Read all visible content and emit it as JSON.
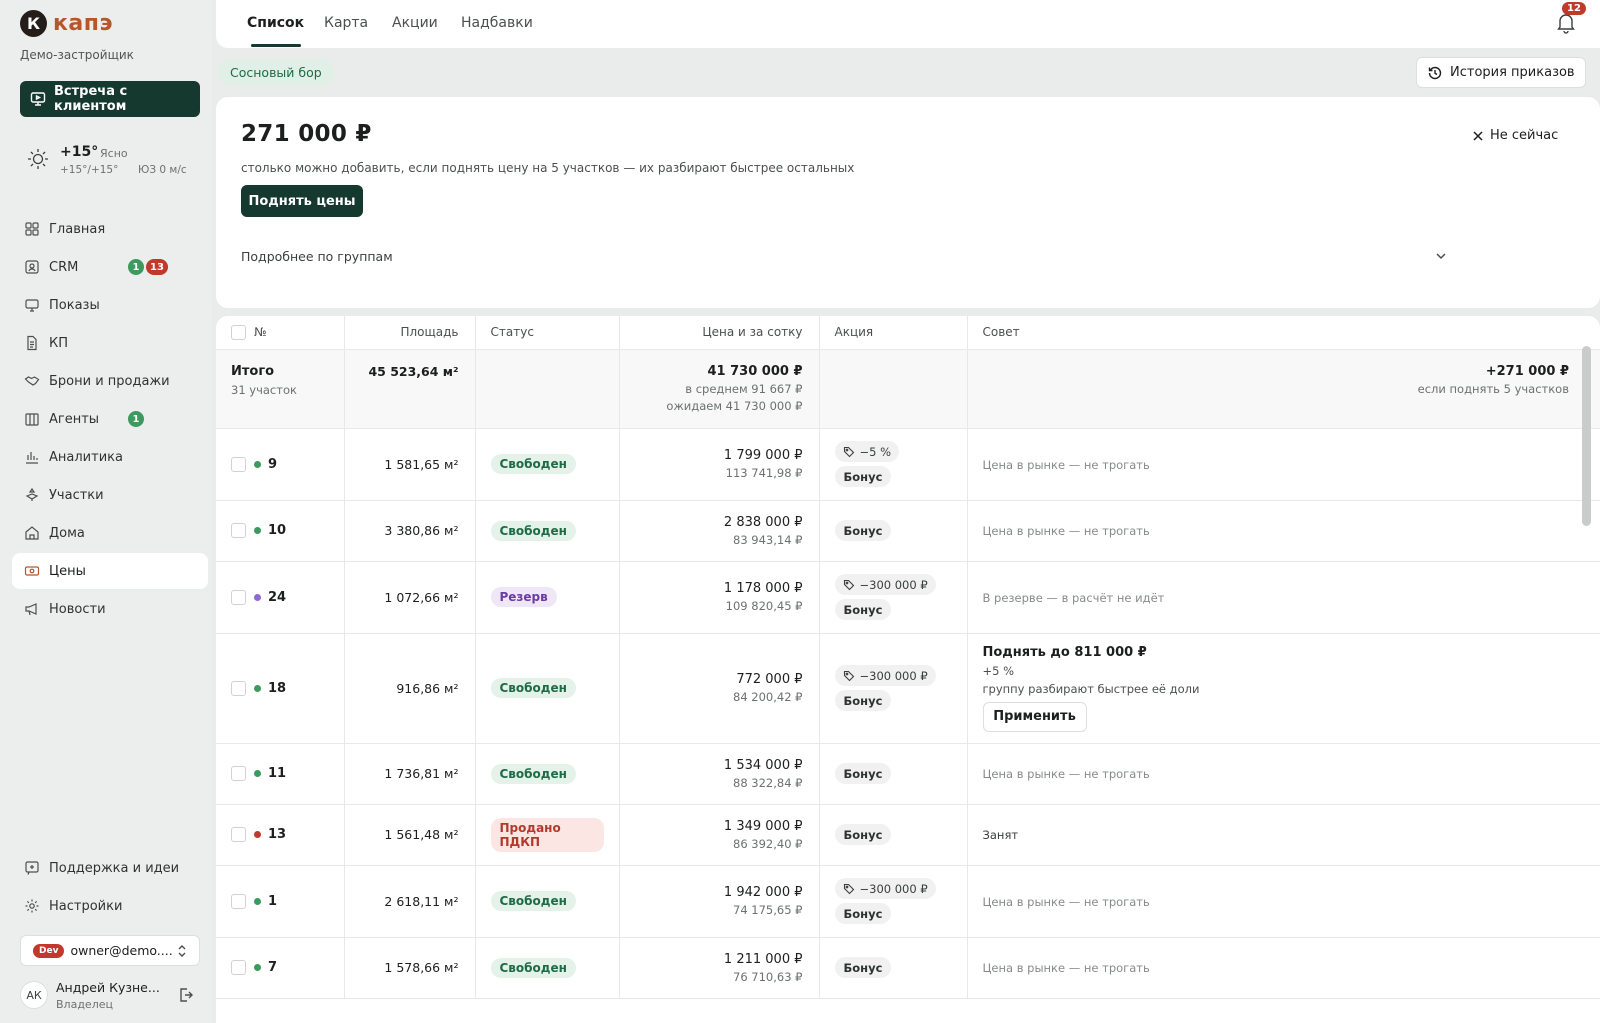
{
  "brand": {
    "mark": "К",
    "name": "капэ",
    "developer": "Демо-застройщик"
  },
  "meet_button": "Встреча с клиентом",
  "weather": {
    "temp": "+15°",
    "condition": "Ясно",
    "range": "+15°/+15°",
    "wind": "ЮЗ 0 м/с"
  },
  "nav": [
    {
      "label": "Главная",
      "icon": "grid-icon"
    },
    {
      "label": "CRM",
      "icon": "contact-icon",
      "badges": [
        {
          "text": "1",
          "color": "green"
        },
        {
          "text": "13",
          "color": "red"
        }
      ]
    },
    {
      "label": "Показы",
      "icon": "screen-icon"
    },
    {
      "label": "КП",
      "icon": "document-icon"
    },
    {
      "label": "Брони и продажи",
      "icon": "handshake-icon"
    },
    {
      "label": "Агенты",
      "icon": "building-icon",
      "badges": [
        {
          "text": "1",
          "color": "green"
        }
      ]
    },
    {
      "label": "Аналитика",
      "icon": "chart-icon"
    },
    {
      "label": "Участки",
      "icon": "plot-icon"
    },
    {
      "label": "Дома",
      "icon": "home-icon"
    },
    {
      "label": "Цены",
      "icon": "price-icon",
      "active": true
    },
    {
      "label": "Новости",
      "icon": "megaphone-icon"
    }
  ],
  "nav_bottom": [
    {
      "label": "Поддержка и идеи",
      "icon": "feedback-icon"
    },
    {
      "label": "Настройки",
      "icon": "gear-icon"
    }
  ],
  "account": {
    "env": "Dev",
    "email": "owner@demo....",
    "initials": "АК",
    "name": "Андрей Кузне...",
    "role": "Владелец"
  },
  "tabs": [
    "Список",
    "Карта",
    "Акции",
    "Надбавки"
  ],
  "notifications": "12",
  "project": "Сосновый бор",
  "history_button": "История приказов",
  "recommendation": {
    "amount": "271 000 ₽",
    "description": "столько можно добавить, если поднять цену на 5 участков — их разбирают быстрее остальных",
    "action": "Поднять цены",
    "more": "Подробнее по группам",
    "dismiss": "Не сейчас"
  },
  "table": {
    "headers": [
      "№",
      "Площадь",
      "Статус",
      "Цена и за сотку",
      "Акция",
      "Совет"
    ],
    "total": {
      "label": "Итого",
      "count": "31 участок",
      "area": "45 523,64 м²",
      "price": "41 730 000 ₽",
      "avg": "в среднем 91 667 ₽",
      "expected": "ожидаем 41 730 000 ₽",
      "advice_value": "+271 000 ₽",
      "advice_note": "если поднять 5 участков"
    },
    "rows": [
      {
        "num": "9",
        "dot": "#3c9a5f",
        "area": "1 581,65 м²",
        "status": "Свободен",
        "st": "free",
        "price": "1 799 000 ₽",
        "per": "113 741,98 ₽",
        "discount": "−5 %",
        "bonus": "Бонус",
        "advice": "Цена в рынке — не трогать"
      },
      {
        "num": "10",
        "dot": "#3c9a5f",
        "area": "3 380,86 м²",
        "status": "Свободен",
        "st": "free",
        "price": "2 838 000 ₽",
        "per": "83 943,14 ₽",
        "discount": "",
        "bonus": "Бонус",
        "advice": "Цена в рынке — не трогать"
      },
      {
        "num": "24",
        "dot": "#8e6bd1",
        "area": "1 072,66 м²",
        "status": "Резерв",
        "st": "res",
        "price": "1 178 000 ₽",
        "per": "109 820,45 ₽",
        "discount": "−300 000 ₽",
        "bonus": "Бонус",
        "advice": "В резерве — в расчёт не идёт"
      },
      {
        "num": "18",
        "dot": "#3c9a5f",
        "area": "916,86 м²",
        "status": "Свободен",
        "st": "free",
        "price": "772 000 ₽",
        "per": "84 200,42 ₽",
        "discount": "−300 000 ₽",
        "bonus": "Бонус",
        "advice": "",
        "advice_title": "Поднять до 811 000 ₽",
        "advice_pct": "+5 %",
        "advice_note": "группу разбирают быстрее её доли",
        "advice_action": "Применить"
      },
      {
        "num": "11",
        "dot": "#3c9a5f",
        "area": "1 736,81 м²",
        "status": "Свободен",
        "st": "free",
        "price": "1 534 000 ₽",
        "per": "88 322,84 ₽",
        "discount": "",
        "bonus": "Бонус",
        "advice": "Цена в рынке — не трогать"
      },
      {
        "num": "13",
        "dot": "#c0392b",
        "area": "1 561,48 м²",
        "status": "Продано ПДКП",
        "st": "sold",
        "price": "1 349 000 ₽",
        "per": "86 392,40 ₽",
        "discount": "",
        "bonus": "Бонус",
        "advice": "Занят",
        "advice_dark": true
      },
      {
        "num": "1",
        "dot": "#3c9a5f",
        "area": "2 618,11 м²",
        "status": "Свободен",
        "st": "free",
        "price": "1 942 000 ₽",
        "per": "74 175,65 ₽",
        "discount": "−300 000 ₽",
        "bonus": "Бонус",
        "advice": "Цена в рынке — не трогать"
      },
      {
        "num": "7",
        "dot": "#3c9a5f",
        "area": "1 578,66 м²",
        "status": "Свободен",
        "st": "free",
        "price": "1 211 000 ₽",
        "per": "76 710,63 ₽",
        "discount": "",
        "bonus": "Бонус",
        "advice": "Цена в рынке — не трогать"
      }
    ]
  },
  "colors": {
    "accent": "#16392f",
    "brand": "#b5562b",
    "free": "#1e6b45",
    "reserve": "#6b3aa3",
    "sold": "#b23a2c"
  }
}
